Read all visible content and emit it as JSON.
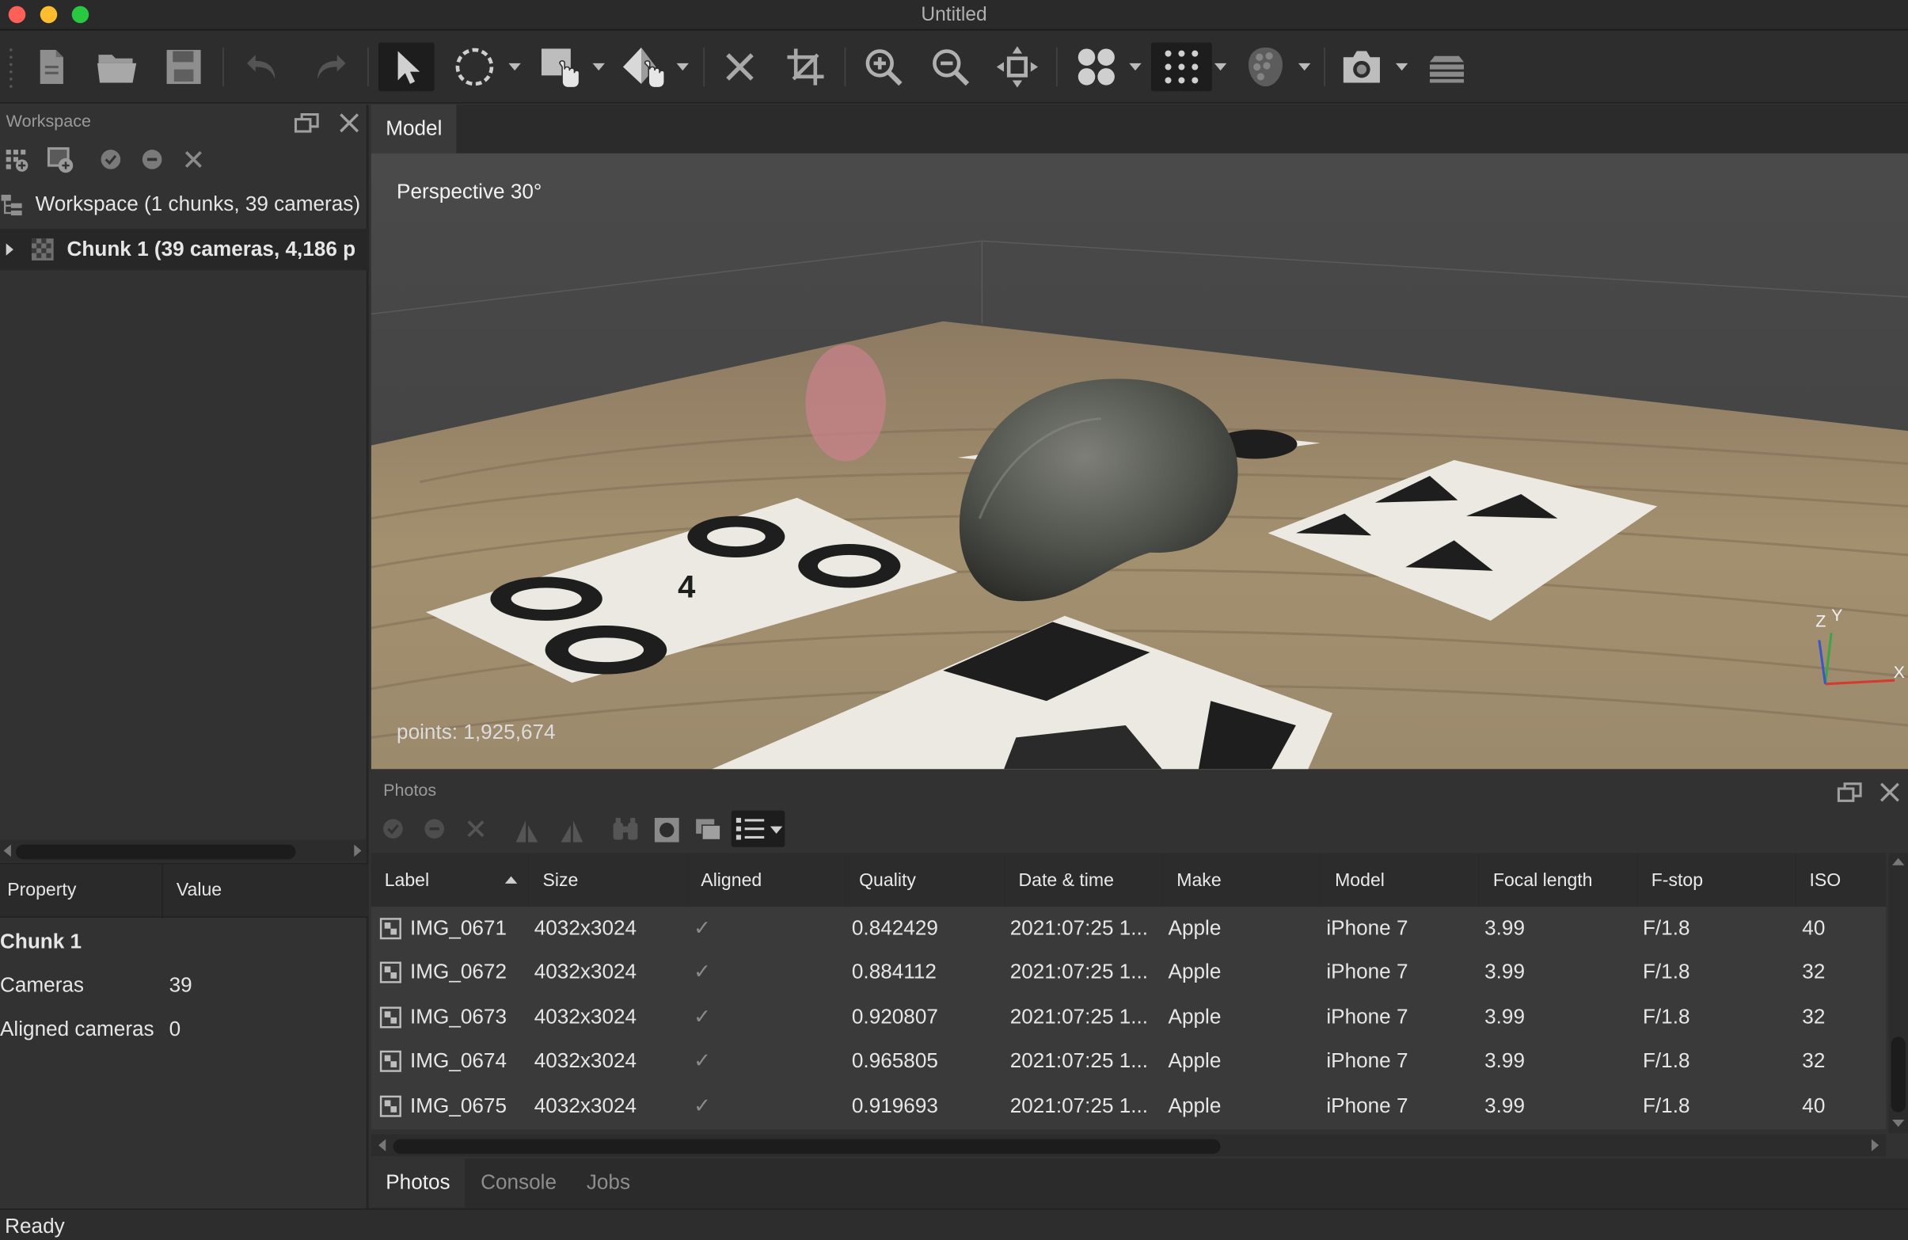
{
  "window": {
    "title": "Untitled"
  },
  "toolbar": {
    "icons": [
      "new-document-icon",
      "open-folder-icon",
      "save-icon",
      "undo-icon",
      "redo-icon",
      "select-arrow-icon",
      "circle-selection-icon",
      "rectangle-selection-hand-icon",
      "move-object-icon",
      "delete-icon",
      "crop-icon",
      "zoom-in-icon",
      "zoom-out-icon",
      "reset-view-icon",
      "dense-points-icon",
      "sparse-points-icon",
      "shaded-mesh-icon",
      "camera-icon",
      "layers-icon"
    ]
  },
  "workspace": {
    "title": "Workspace",
    "root_label": "Workspace (1 chunks, 39 cameras)",
    "chunk_label": "Chunk 1 (39 cameras, 4,186 p"
  },
  "properties": {
    "col_property": "Property",
    "col_value": "Value",
    "group": "Chunk 1",
    "rows": [
      {
        "name": "Cameras",
        "value": "39"
      },
      {
        "name": "Aligned cameras",
        "value": "0"
      }
    ]
  },
  "model_view": {
    "tab_label": "Model",
    "projection": "Perspective 30°",
    "points": "points: 1,925,674",
    "axes": {
      "x": "X",
      "y": "Y",
      "z": "Z"
    }
  },
  "photos": {
    "title": "Photos",
    "columns": [
      "Label",
      "Size",
      "Aligned",
      "Quality",
      "Date & time",
      "Make",
      "Model",
      "Focal length",
      "F-stop",
      "ISO"
    ],
    "rows": [
      {
        "label": "IMG_0671",
        "size": "4032x3024",
        "aligned": "✓",
        "quality": "0.842429",
        "datetime": "2021:07:25 1...",
        "make": "Apple",
        "model": "iPhone 7",
        "focal": "3.99",
        "fstop": "F/1.8",
        "iso": "40"
      },
      {
        "label": "IMG_0672",
        "size": "4032x3024",
        "aligned": "✓",
        "quality": "0.884112",
        "datetime": "2021:07:25 1...",
        "make": "Apple",
        "model": "iPhone 7",
        "focal": "3.99",
        "fstop": "F/1.8",
        "iso": "32"
      },
      {
        "label": "IMG_0673",
        "size": "4032x3024",
        "aligned": "✓",
        "quality": "0.920807",
        "datetime": "2021:07:25 1...",
        "make": "Apple",
        "model": "iPhone 7",
        "focal": "3.99",
        "fstop": "F/1.8",
        "iso": "32"
      },
      {
        "label": "IMG_0674",
        "size": "4032x3024",
        "aligned": "✓",
        "quality": "0.965805",
        "datetime": "2021:07:25 1...",
        "make": "Apple",
        "model": "iPhone 7",
        "focal": "3.99",
        "fstop": "F/1.8",
        "iso": "32"
      },
      {
        "label": "IMG_0675",
        "size": "4032x3024",
        "aligned": "✓",
        "quality": "0.919693",
        "datetime": "2021:07:25 1...",
        "make": "Apple",
        "model": "iPhone 7",
        "focal": "3.99",
        "fstop": "F/1.8",
        "iso": "40"
      }
    ]
  },
  "bottom_tabs": [
    "Photos",
    "Console",
    "Jobs"
  ],
  "status": "Ready"
}
